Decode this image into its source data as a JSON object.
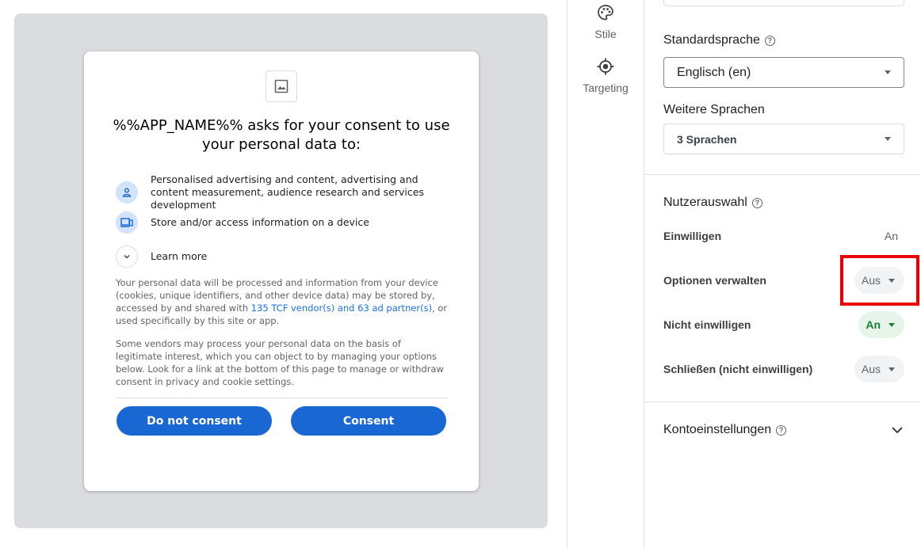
{
  "preview": {
    "dialog": {
      "title": "%%APP_NAME%% asks for your consent to use your personal data to:",
      "purposes": [
        {
          "icon": "person-icon",
          "text": "Personalised advertising and content, advertising and content measurement, audience research and services development"
        },
        {
          "icon": "devices-icon",
          "text": "Store and/or access information on a device"
        }
      ],
      "learn_more": "Learn more",
      "paragraph1_before": "Your personal data will be processed and information from your device (cookies, unique identifiers, and other device data) may be stored by, accessed by and shared with ",
      "paragraph1_link": "135 TCF vendor(s) and 63 ad partner(s)",
      "paragraph1_after": ", or used specifically by this site or app.",
      "paragraph2": "Some vendors may process your personal data on the basis of legitimate interest, which you can object to by managing your options below. Look for a link at the bottom of this page to manage or withdraw consent in privacy and cookie settings.",
      "buttons": {
        "do_not_consent": "Do not consent",
        "consent": "Consent"
      }
    }
  },
  "nav": {
    "items": [
      {
        "icon": "palette-icon",
        "label": "Stile"
      },
      {
        "icon": "target-icon",
        "label": "Targeting"
      }
    ]
  },
  "settings": {
    "default_language": {
      "label": "Standardsprache",
      "value": "Englisch (en)"
    },
    "more_languages": {
      "label": "Weitere Sprachen",
      "value": "3 Sprachen"
    },
    "user_choices": {
      "label": "Nutzerauswahl",
      "options": [
        {
          "name": "Einwilligen",
          "value": "An"
        },
        {
          "name": "Optionen verwalten",
          "value": "Aus"
        },
        {
          "name": "Nicht einwilligen",
          "value": "An"
        },
        {
          "name": "Schließen (nicht einwilligen)",
          "value": "Aus"
        }
      ]
    },
    "account_settings": {
      "label": "Kontoeinstellungen"
    }
  },
  "colors": {
    "accent": "#1967d2",
    "on_green": "#188038",
    "highlight": "#ea0000"
  }
}
